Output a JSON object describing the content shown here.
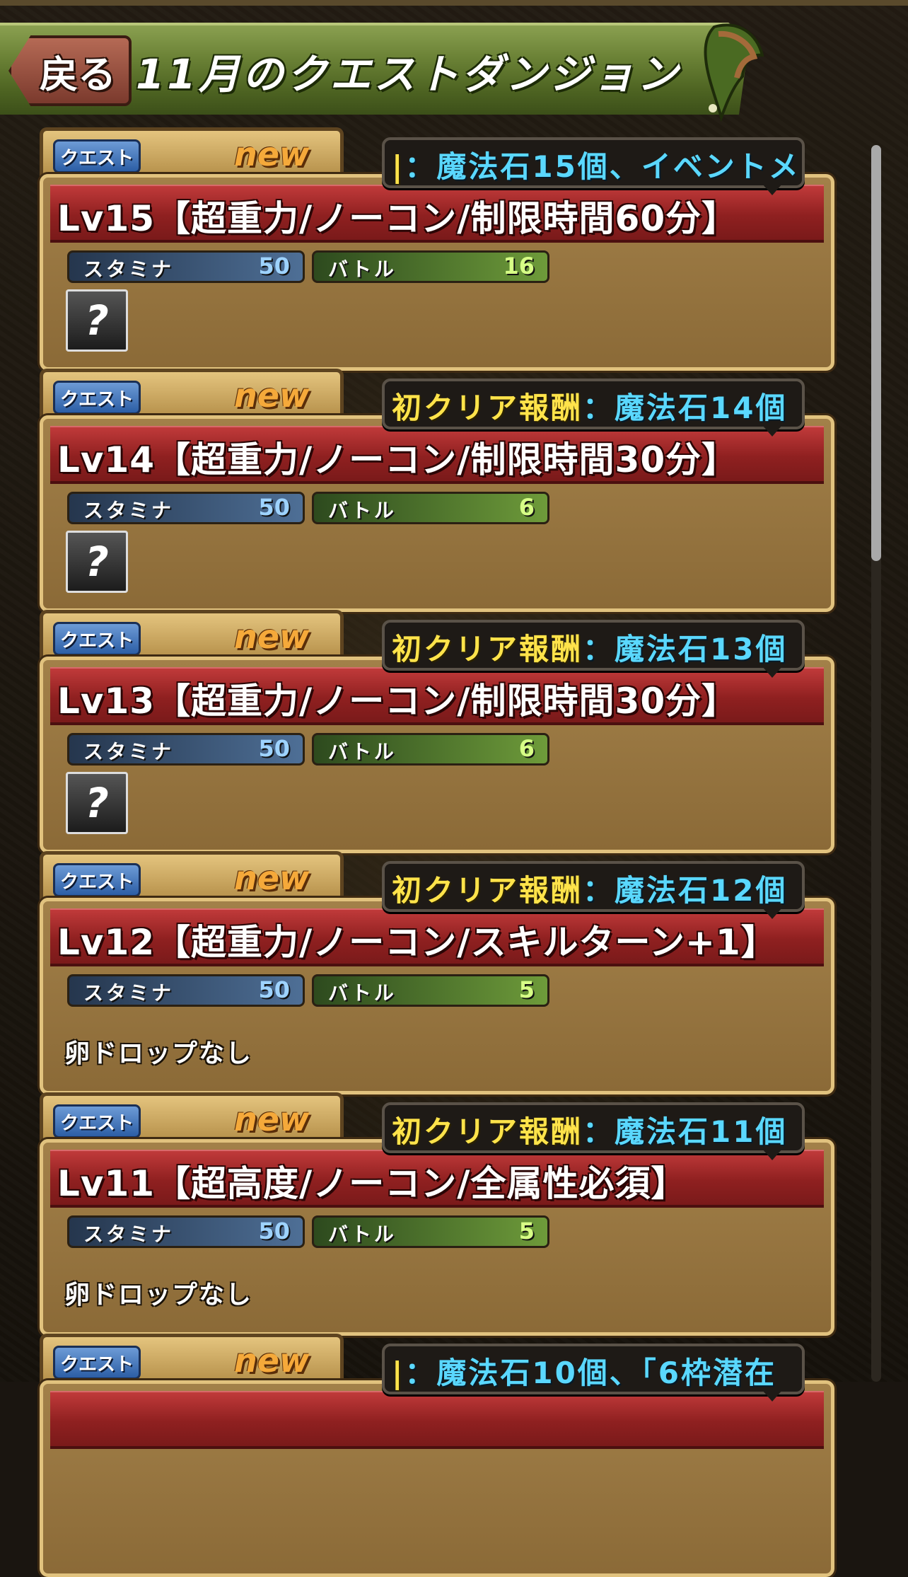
{
  "header": {
    "back_label": "戻る",
    "title": "11月のクエストダンジョン"
  },
  "card_common": {
    "tab_label": "クエスト",
    "new_badge": "new",
    "stamina_label": "スタミナ",
    "battle_label": "バトル"
  },
  "quests": [
    {
      "title": "Lv15【超重力/ノーコン/制限時間60分】",
      "reward_prefix": "|",
      "reward_text": "：魔法石15個、イベントメ",
      "stamina": "50",
      "battles": "16",
      "drop": "?"
    },
    {
      "title": "Lv14【超重力/ノーコン/制限時間30分】",
      "reward_prefix": "初クリア報酬",
      "reward_text": "：魔法石14個",
      "stamina": "50",
      "battles": "6",
      "drop": "?"
    },
    {
      "title": "Lv13【超重力/ノーコン/制限時間30分】",
      "reward_prefix": "初クリア報酬",
      "reward_text": "：魔法石13個",
      "stamina": "50",
      "battles": "6",
      "drop": "?"
    },
    {
      "title": "Lv12【超重力/ノーコン/スキルターン+1】",
      "reward_prefix": "初クリア報酬",
      "reward_text": "：魔法石12個",
      "stamina": "50",
      "battles": "5",
      "drop": "卵ドロップなし"
    },
    {
      "title": "Lv11【超高度/ノーコン/全属性必須】",
      "reward_prefix": "初クリア報酬",
      "reward_text": "：魔法石11個",
      "stamina": "50",
      "battles": "5",
      "drop": "卵ドロップなし"
    },
    {
      "title": "",
      "reward_prefix": "|",
      "reward_text": "：魔法石10個、「6枠潜在",
      "stamina": "",
      "battles": "",
      "drop": ""
    }
  ],
  "colors": {
    "header_green": "#6b8236",
    "title_red": "#8f2020",
    "reward_cyan": "#5ad8ff",
    "reward_yellow": "#ffe34a"
  }
}
